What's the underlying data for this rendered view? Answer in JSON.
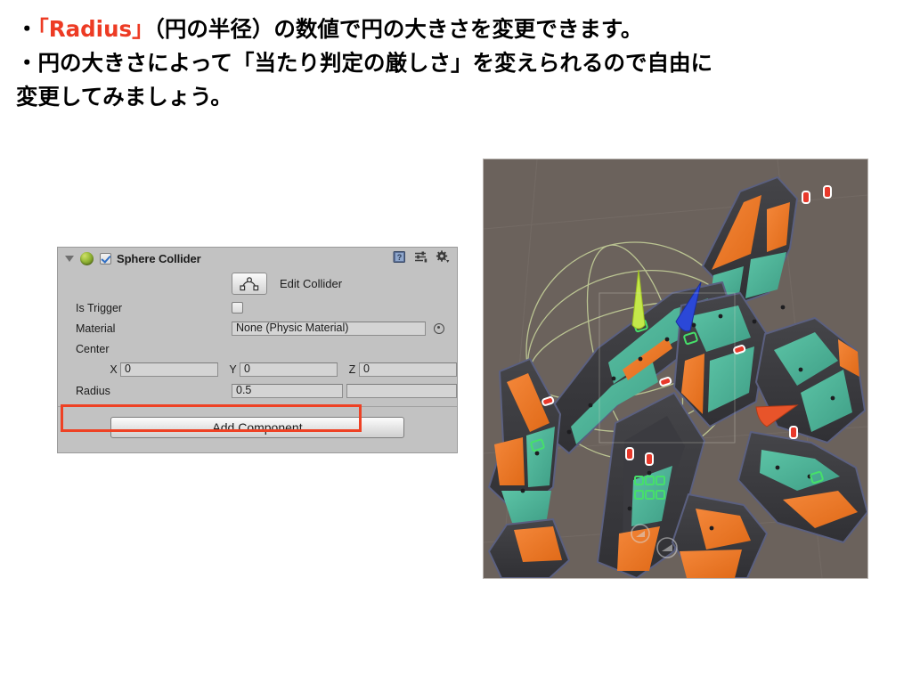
{
  "slide": {
    "lines": [
      {
        "prefix": "・",
        "accent": "「Radius」",
        "rest": "（円の半径）の数値で円の大きさを変更できます。"
      },
      {
        "prefix": "",
        "accent": "",
        "rest": "・円の大きさによって「当たり判定の厳しさ」を変えられるので自由に"
      },
      {
        "prefix": "",
        "accent": "",
        "rest": "変更してみましょう。"
      }
    ],
    "line1_prefix": "・",
    "line1_accent": "「Radius」",
    "line1_rest": "（円の半径）の数値で円の大きさを変更できます。",
    "line2": "・円の大きさによって「当たり判定の厳しさ」を変えられるので自由に",
    "line3": "変更してみましょう。",
    "accent_color": "#ED3B24"
  },
  "inspector": {
    "component": {
      "title": "Sphere Collider",
      "enabled_checkbox": true,
      "foldout_expanded": true,
      "icon_name": "sphere-collider-icon",
      "header_icons": [
        "help-book-icon",
        "preset-sliders-icon",
        "gear-icon"
      ]
    },
    "edit_collider": {
      "button_icon": "edit-collider-icon",
      "label": "Edit Collider"
    },
    "properties": [
      {
        "label": "Is Trigger",
        "type": "checkbox",
        "value": false
      },
      {
        "label": "Material",
        "type": "object",
        "value": "None (Physic Material)",
        "picker": "object-picker-icon"
      },
      {
        "label": "Center",
        "type": "header"
      }
    ],
    "is_trigger_label": "Is Trigger",
    "material_label": "Material",
    "material_value": "None (Physic Material)",
    "center_label": "Center",
    "center": {
      "x_label": "X",
      "x_value": "0",
      "y_label": "Y",
      "y_value": "0",
      "z_label": "Z",
      "z_value": "0"
    },
    "radius": {
      "label": "Radius",
      "value": "0.5",
      "highlight_color": "#EE4124"
    },
    "add_component_label": "Add Component"
  },
  "scene": {
    "name": "unity-scene-view",
    "background_color": "#6b625c",
    "gizmo": {
      "y_axis_color": "#c4e84a",
      "z_axis_color": "#2b48d8",
      "x_axis_color": "#e8542a"
    },
    "collider_wire_color": "#c6d49a",
    "ship_colors": {
      "teal": "#4fb79b",
      "orange": "#ef7d2b",
      "dark": "#3b3b3f",
      "outline": "#5b6080"
    }
  }
}
